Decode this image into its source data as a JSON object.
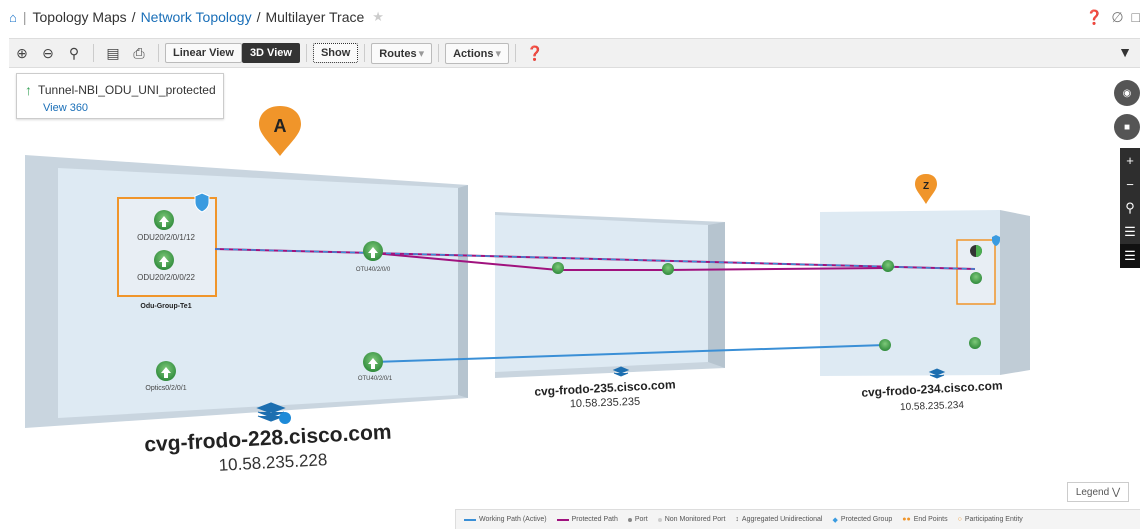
{
  "breadcrumb": {
    "home_icon": "home-icon",
    "items": [
      "Topology Maps",
      "Network Topology",
      "Multilayer Trace"
    ]
  },
  "toolbar": {
    "linear_view": "Linear View",
    "view_3d": "3D View",
    "show": "Show",
    "routes": "Routes",
    "actions": "Actions"
  },
  "info": {
    "service_name": "Tunnel-NBI_ODU_UNI_protected",
    "view_link": "View 360"
  },
  "markers": {
    "a": "A",
    "z": "Z"
  },
  "devices": {
    "d228": {
      "name": "cvg-frodo-228.cisco.com",
      "ip": "10.58.235.228",
      "ports": [
        "ODU20/2/0/1/12",
        "ODU20/2/0/0/22",
        "OTU40/2/0/0",
        "Optics0/2/0/1",
        "OTU40/2/0/1"
      ],
      "group": "Odu-Group-Te1"
    },
    "d235": {
      "name": "cvg-frodo-235.cisco.com",
      "ip": "10.58.235.235"
    },
    "d234": {
      "name": "cvg-frodo-234.cisco.com",
      "ip": "10.58.235.234"
    }
  },
  "legend": {
    "button": "Legend",
    "items": [
      "Working Path (Active)",
      "Protected Path",
      "Port",
      "Non Monitored Port",
      "Aggregated Unidirectional",
      "Protected Group",
      "End Points",
      "Participating Entity"
    ]
  },
  "colors": {
    "working": "#3a8fd6",
    "protected": "#a0127e",
    "accent": "#1a6fb8",
    "port": "#3aa35a",
    "marker": "#f0952a"
  }
}
